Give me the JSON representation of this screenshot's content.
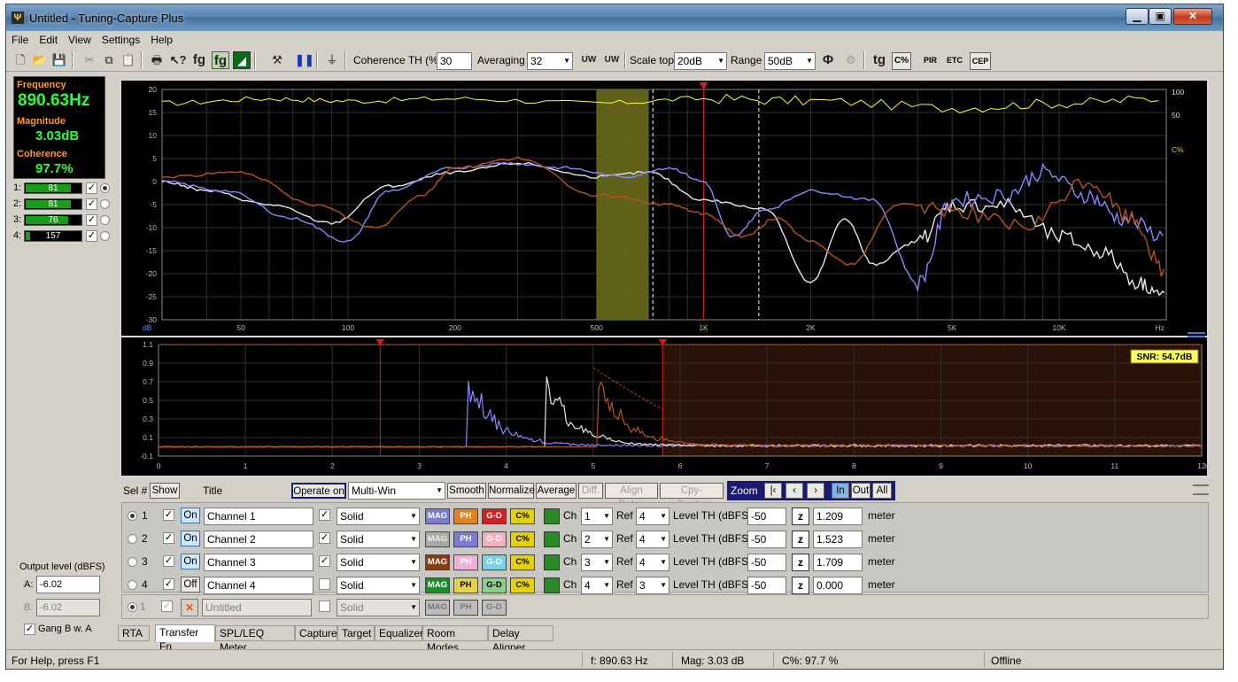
{
  "window": {
    "title": "Untitled - Tuning-Capture Plus"
  },
  "menu": [
    "File",
    "Edit",
    "View",
    "Settings",
    "Help"
  ],
  "toolbar": {
    "coherence_label": "Coherence TH (%)",
    "coherence_value": "30",
    "averaging_label": "Averaging",
    "averaging_value": "32",
    "scale_top_label": "Scale top",
    "scale_top_value": "20dB",
    "range_label": "Range",
    "range_value": "50dB",
    "fg_label": "fg",
    "fg2_label": "fg",
    "tg_label": "tg",
    "cpct_label": "C%",
    "pir_label": "PIR",
    "etc_label": "ETC",
    "cep_label": "CEP",
    "uw1_label": "UW",
    "uw2_label": "UW"
  },
  "readout": {
    "frequency_label": "Frequency",
    "frequency_value": "890.63Hz",
    "magnitude_label": "Magnitude",
    "magnitude_value": "3.03dB",
    "coherence_label": "Coherence",
    "coherence_value": "97.7%"
  },
  "channel_levels": [
    {
      "num": "1:",
      "value": "81",
      "level": 0.8
    },
    {
      "num": "2:",
      "value": "81",
      "level": 0.8
    },
    {
      "num": "3:",
      "value": "76",
      "level": 0.75
    },
    {
      "num": "4:",
      "value": "157",
      "level": 0.05
    }
  ],
  "output": {
    "label": "Output level (dBFS)",
    "a_label": "A:",
    "a_value": "-6.02",
    "b_label": "B:",
    "b_value": "-6.02",
    "gang_label": "Gang B w. A"
  },
  "chart_data": [
    {
      "type": "line",
      "title": "",
      "ylabel": "dB",
      "xlabel": "Hz",
      "x_scale": "log",
      "ylim": [
        -30,
        20
      ],
      "y_ticks": [
        "20",
        "15",
        "10",
        "5",
        "0",
        "-5",
        "-10",
        "-15",
        "-20",
        "-25",
        "-30"
      ],
      "x_ticks": [
        "50",
        "100",
        "200",
        "500",
        "1K",
        "2K",
        "5K",
        "10K"
      ],
      "right_axis_ticks": [
        "100",
        "50",
        "C%"
      ],
      "cursor_frequency": 1000,
      "series": [
        {
          "color": "#ffff33",
          "values_x": [
            30,
            60,
            100,
            200,
            500,
            1000,
            2000,
            5000,
            10000,
            20000
          ],
          "values_y": [
            17,
            18,
            17.5,
            18,
            17,
            18,
            17.5,
            16,
            17,
            18
          ]
        },
        {
          "color": "#e6e6e6",
          "values_x": [
            30,
            40,
            60,
            90,
            130,
            200,
            300,
            500,
            700,
            1000,
            1500,
            2000,
            2500,
            3000,
            4000,
            5000,
            7000,
            10000,
            13000,
            17000,
            20000
          ],
          "values_y": [
            0,
            -2,
            -5,
            -9,
            -1,
            2,
            4,
            1,
            2,
            -4,
            -6,
            -22,
            -8,
            -18,
            -13,
            -5,
            -5,
            -12,
            -15,
            -22,
            -25
          ]
        },
        {
          "color": "#8888ff",
          "values_x": [
            30,
            45,
            70,
            100,
            130,
            200,
            280,
            400,
            600,
            800,
            1000,
            1200,
            1500,
            2000,
            3000,
            4000,
            5000,
            7000,
            9000,
            12000,
            15000,
            20000
          ],
          "values_y": [
            0,
            -2,
            -8,
            -13,
            -2,
            3,
            4,
            3,
            1,
            3,
            0,
            -12,
            -6,
            -2,
            -4,
            -22,
            -4,
            -3,
            2,
            -3,
            -8,
            -12
          ]
        },
        {
          "color": "#b5541a",
          "values_x": [
            30,
            50,
            80,
            120,
            160,
            200,
            300,
            500,
            800,
            1000,
            1300,
            1600,
            2000,
            2600,
            3500,
            5000,
            8000,
            12000,
            16000,
            20000
          ],
          "values_y": [
            1,
            2,
            -5,
            -10,
            -3,
            3,
            5,
            -3,
            -5,
            -7,
            -12,
            -8,
            -13,
            -18,
            -5,
            -6,
            -10,
            0,
            -8,
            -20
          ]
        }
      ]
    },
    {
      "type": "line",
      "title": "",
      "xlabel": "ms",
      "xlim": [
        0,
        12
      ],
      "ylim": [
        -0.1,
        1.1
      ],
      "y_ticks": [
        "1.1",
        "0.9",
        "0.7",
        "0.5",
        "0.3",
        "0.1",
        "-0.1"
      ],
      "x_ticks": [
        "0",
        "1",
        "2",
        "3",
        "4",
        "5",
        "6",
        "7",
        "8",
        "9",
        "10",
        "11",
        "12"
      ],
      "annotation": "SNR: 54.7dB",
      "series": [
        {
          "color": "#8888ff",
          "peak_x": 3.55,
          "peak_y": 0.95
        },
        {
          "color": "#e6e6e6",
          "peak_x": 4.45,
          "peak_y": 0.9
        },
        {
          "color": "#b5541a",
          "peak_x": 5.05,
          "peak_y": 0.92
        }
      ]
    }
  ],
  "controls": {
    "sel_label": "Sel #",
    "show_label": "Show",
    "title_label": "Title",
    "operate_on": "Operate on",
    "multi_win": "Multi-Win",
    "smooth": "Smooth",
    "normalize": "Normalize",
    "average": "Average",
    "diff": "Diff.",
    "align_delay": "Align Delay",
    "cpy_capture": "Cpy->Capture",
    "zoom": "Zoom",
    "zoom_in": "In",
    "zoom_out": "Out",
    "zoom_all": "All"
  },
  "channels": [
    {
      "num": "1",
      "on": "On",
      "title": "Channel 1",
      "style": "Solid",
      "ch_label": "Ch",
      "ch": "1",
      "ref_label": "Ref",
      "ref": "4",
      "level_label": "Level TH (dBFS)",
      "level": "-50",
      "dist": "1.209",
      "unit": "meter",
      "mag": "MAG",
      "ph": "PH",
      "gd": "G-D",
      "cp": "C%"
    },
    {
      "num": "2",
      "on": "On",
      "title": "Channel 2",
      "style": "Solid",
      "ch_label": "Ch",
      "ch": "2",
      "ref_label": "Ref",
      "ref": "4",
      "level_label": "Level TH (dBFS)",
      "level": "-50",
      "dist": "1.523",
      "unit": "meter",
      "mag": "MAG",
      "ph": "PH",
      "gd": "G-D",
      "cp": "C%"
    },
    {
      "num": "3",
      "on": "On",
      "title": "Channel 3",
      "style": "Solid",
      "ch_label": "Ch",
      "ch": "3",
      "ref_label": "Ref",
      "ref": "4",
      "level_label": "Level TH (dBFS)",
      "level": "-50",
      "dist": "1.709",
      "unit": "meter",
      "mag": "MAG",
      "ph": "PH",
      "gd": "G-D",
      "cp": "C%"
    },
    {
      "num": "4",
      "on": "Off",
      "title": "Channel 4",
      "style": "Solid",
      "ch_label": "Ch",
      "ch": "4",
      "ref_label": "Ref",
      "ref": "3",
      "level_label": "Level TH (dBFS)",
      "level": "-50",
      "dist": "0.000",
      "unit": "meter",
      "mag": "MAG",
      "ph": "PH",
      "gd": "G-D",
      "cp": "C%"
    }
  ],
  "capture_row": {
    "num": "1",
    "title": "Untitled",
    "style": "Solid",
    "mag": "MAG",
    "ph": "PH",
    "gd": "G-D"
  },
  "tabs": [
    "RTA",
    "Transfer Fn",
    "SPL/LEQ Meter",
    "Capture",
    "Target",
    "Equalizer",
    "Room Modes",
    "Delay Aligner"
  ],
  "status": {
    "help": "For Help, press F1",
    "freq": "f: 890.63 Hz",
    "mag": "Mag: 3.03 dB",
    "coh": "C%: 97.7 %",
    "state": "Offline"
  }
}
